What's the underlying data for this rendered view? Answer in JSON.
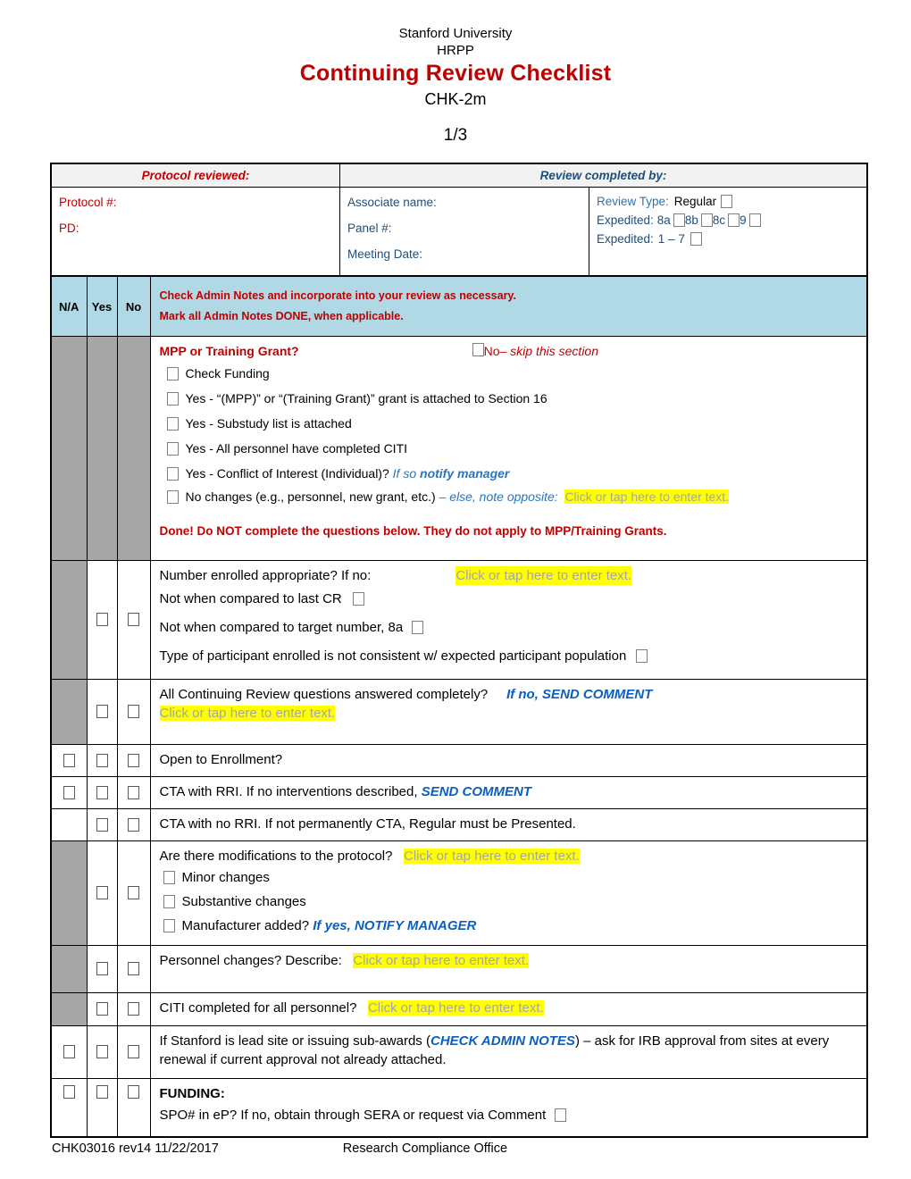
{
  "header": {
    "university": "Stanford University",
    "program": "HRPP",
    "title": "Continuing Review Checklist",
    "code": "CHK-2m",
    "page": "1/3"
  },
  "info_table": {
    "header_left": "Protocol reviewed:",
    "header_right": "Review completed by:",
    "protocol_number_label": "Protocol #:",
    "pd_label": "PD:",
    "associate_name_label": "Associate name:",
    "panel_number_label": "Panel #:",
    "meeting_date_label": "Meeting Date:",
    "review_type_label": "Review Type:",
    "review_type_regular": "Regular",
    "expedited_label_a": "Expedited:",
    "expedited_8a": "8a",
    "expedited_8b": "8b",
    "expedited_8c": "8c",
    "expedited_9": "9",
    "expedited_label_b": "Expedited:",
    "expedited_1_7": "1 – 7"
  },
  "checklist": {
    "columns": {
      "na": "N/A",
      "yes": "Yes",
      "no": "No"
    },
    "admin_note_line1": "Check Admin Notes and incorporate into your review as necessary.",
    "admin_note_line2": "Mark all Admin Notes DONE, when applicable.",
    "mpp": {
      "question": "MPP or Training Grant?",
      "no_skip_text": "No",
      "no_skip_italic": " – skip this section",
      "items": [
        "Check Funding",
        "Yes - “(MPP)” or “(Training Grant)” grant is attached to Section 16",
        "Yes - Substudy list is attached",
        "Yes - All personnel have completed CITI"
      ],
      "coi_prefix": "Yes - Conflict of Interest (Individual)? ",
      "coi_italic": "If so ",
      "coi_bold_italic": "notify manager",
      "nochange_prefix": "No changes (e.g., personnel, new grant, etc.) ",
      "nochange_italic": "– else, note opposite:",
      "nochange_placeholder": "Click or tap here to enter text.",
      "done_note": "Done!  Do NOT complete the questions below.  They do not apply to MPP/Training Grants."
    },
    "enrolled": {
      "question": "Number enrolled appropriate?   If no:",
      "placeholder": "Click or tap here to enter text.",
      "sub1": "Not when compared to last CR",
      "sub2": "Not when compared to target number, 8a",
      "sub3": "Type of participant enrolled is not consistent w/ expected participant population"
    },
    "cr_questions": {
      "question": "All Continuing Review questions answered completely?",
      "emphasis": "If no, SEND COMMENT",
      "placeholder": "Click or tap here to enter text."
    },
    "open_enrollment": {
      "question": "Open to Enrollment?"
    },
    "cta_rri": {
      "prefix": "CTA with RRI.  If no interventions described, ",
      "emphasis": "SEND COMMENT"
    },
    "cta_no_rri": {
      "text": "CTA with no RRI. If not permanently CTA, Regular must be Presented."
    },
    "modifications": {
      "question": "Are there modifications to the protocol?",
      "placeholder": "Click or tap here to enter text.",
      "sub1": "Minor changes",
      "sub2": "Substantive changes",
      "sub3_prefix": "Manufacturer added?  ",
      "sub3_emphasis": "If yes, NOTIFY MANAGER"
    },
    "personnel": {
      "question": "Personnel changes?  Describe:",
      "placeholder": "Click or tap here to enter text."
    },
    "citi": {
      "question": "CITI completed for all personnel?",
      "placeholder": "Click or tap here to enter text."
    },
    "lead_site": {
      "prefix": "If Stanford is lead site or issuing sub-awards (",
      "emphasis": "CHECK ADMIN NOTES",
      "suffix": ") – ask for IRB approval from sites at every renewal if current approval not already attached."
    },
    "funding": {
      "title": "FUNDING:",
      "line": "SPO# in eP?  If no, obtain through SERA or request via Comment"
    }
  },
  "footer": {
    "left": "CHK03016 rev14 11/22/2017",
    "right": "Research Compliance Office"
  }
}
